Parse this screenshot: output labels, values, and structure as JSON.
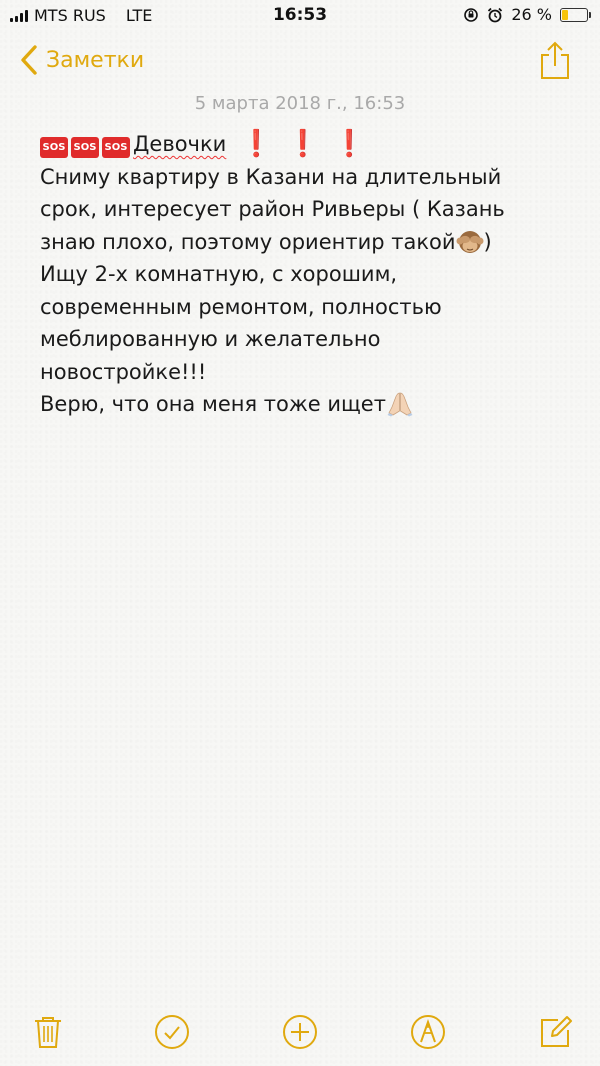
{
  "status_bar": {
    "carrier": "MTS RUS",
    "network": "LTE",
    "time": "16:53",
    "battery_percent_text": "26 %",
    "battery_level": 0.26
  },
  "nav": {
    "back_label": "Заметки"
  },
  "note": {
    "date": "5 марта 2018 г., 16:53",
    "sos_badge": "SOS",
    "title_word": "Девочки",
    "exclamation": "❗",
    "lines": [
      "Сниму квартиру в Казани на длительный",
      "срок, интересует район Ривьеры ( Казань",
      "знаю плохо, поэтому ориентир такой",
      "Ищу 2-х комнатную, с хорошим,",
      "современным ремонтом, полностью",
      "меблированную и желательно",
      "новостройке!!!",
      "Верю, что она меня тоже ищет"
    ],
    "line3_suffix": ")"
  },
  "colors": {
    "accent": "#e0a90f",
    "sos_red": "#e02b2b",
    "date_gray": "#a9a9a9"
  },
  "icons": {
    "back": "chevron-left-icon",
    "share": "share-icon",
    "trash": "trash-icon",
    "check": "checkmark-circle-icon",
    "add": "plus-circle-icon",
    "markup": "pen-circle-icon",
    "compose": "compose-icon"
  }
}
